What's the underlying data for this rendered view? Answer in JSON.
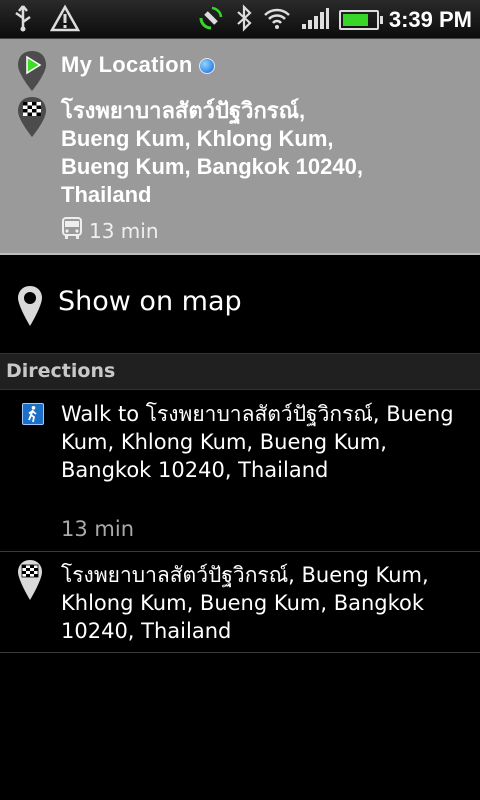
{
  "status_bar": {
    "time": "3:39 PM",
    "icons": [
      "usb-icon",
      "warning-icon",
      "gps-icon",
      "bluetooth-icon",
      "wifi-icon",
      "signal-icon",
      "battery-icon"
    ],
    "battery_level": 0.85
  },
  "route": {
    "origin": "My Location",
    "destination": "โรงพยาบาลสัตว์ปัฐวิกรณ์, Bueng Kum, Khlong Kum, Bueng Kum, Bangkok 10240, Thailand",
    "duration": "13 min"
  },
  "show_on_map": {
    "label": "Show on map"
  },
  "directions": {
    "header": "Directions",
    "steps": [
      {
        "text": "Walk to โรงพยาบาลสัตว์ปัฐวิกรณ์, Bueng Kum, Khlong Kum, Bueng Kum, Bangkok 10240, Thailand",
        "time": "13 min"
      },
      {
        "text": "โรงพยาบาลสัตว์ปัฐวิกรณ์, Bueng Kum, Khlong Kum, Bueng Kum, Bangkok 10240, Thailand"
      }
    ]
  },
  "colors": {
    "summary_bg": "#9a9a9a",
    "walk_icon": "#1c6fc6",
    "battery": "#39d62a"
  }
}
